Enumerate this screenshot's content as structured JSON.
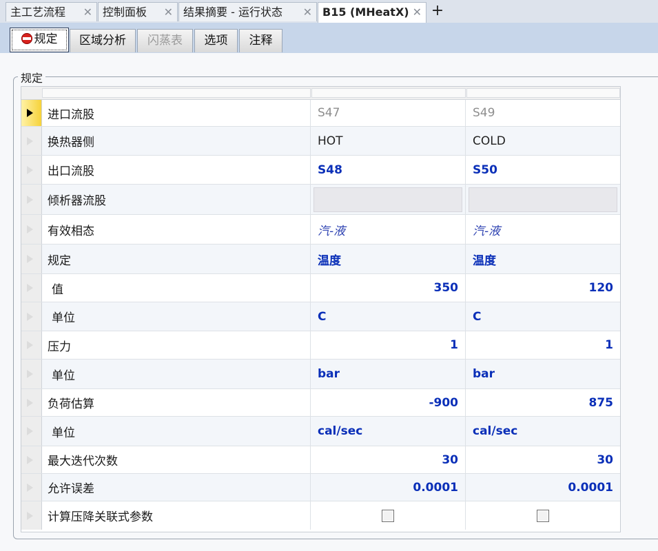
{
  "doc_tabs": [
    {
      "label": "主工艺流程"
    },
    {
      "label": "控制面板"
    },
    {
      "label": "结果摘要 - 运行状态"
    },
    {
      "label": "B15 (MHeatX)"
    }
  ],
  "close_glyph": "✕",
  "add_tab_glyph": "+",
  "form_tabs": [
    {
      "label": "规定",
      "state": "active"
    },
    {
      "label": "区域分析"
    },
    {
      "label": "闪蒸表",
      "state": "disabled"
    },
    {
      "label": "选项"
    },
    {
      "label": "注释"
    }
  ],
  "group_title": "规定",
  "rows": [
    {
      "label": "进口流股",
      "v1": "S47",
      "v2": "S49"
    },
    {
      "label": "换热器侧",
      "v1": "HOT",
      "v2": "COLD"
    },
    {
      "label": "出口流股",
      "v1": "S48",
      "v2": "S50"
    },
    {
      "label": "倾析器流股",
      "v1": "",
      "v2": ""
    },
    {
      "label": "有效相态",
      "v1": "汽-液",
      "v2": "汽-液"
    },
    {
      "label": "规定",
      "v1": "温度",
      "v2": "温度"
    },
    {
      "label": "值",
      "v1": "350",
      "v2": "120"
    },
    {
      "label": "单位",
      "v1": "C",
      "v2": "C"
    },
    {
      "label": "压力",
      "v1": "1",
      "v2": "1"
    },
    {
      "label": "单位",
      "v1": "bar",
      "v2": "bar"
    },
    {
      "label": "负荷估算",
      "v1": "-900",
      "v2": "875"
    },
    {
      "label": "单位",
      "v1": "cal/sec",
      "v2": "cal/sec"
    },
    {
      "label": "最大迭代次数",
      "v1": "30",
      "v2": "30"
    },
    {
      "label": "允许误差",
      "v1": "0.0001",
      "v2": "0.0001"
    },
    {
      "label": "计算压降关联式参数",
      "v1_checked": false,
      "v2_checked": false
    }
  ]
}
